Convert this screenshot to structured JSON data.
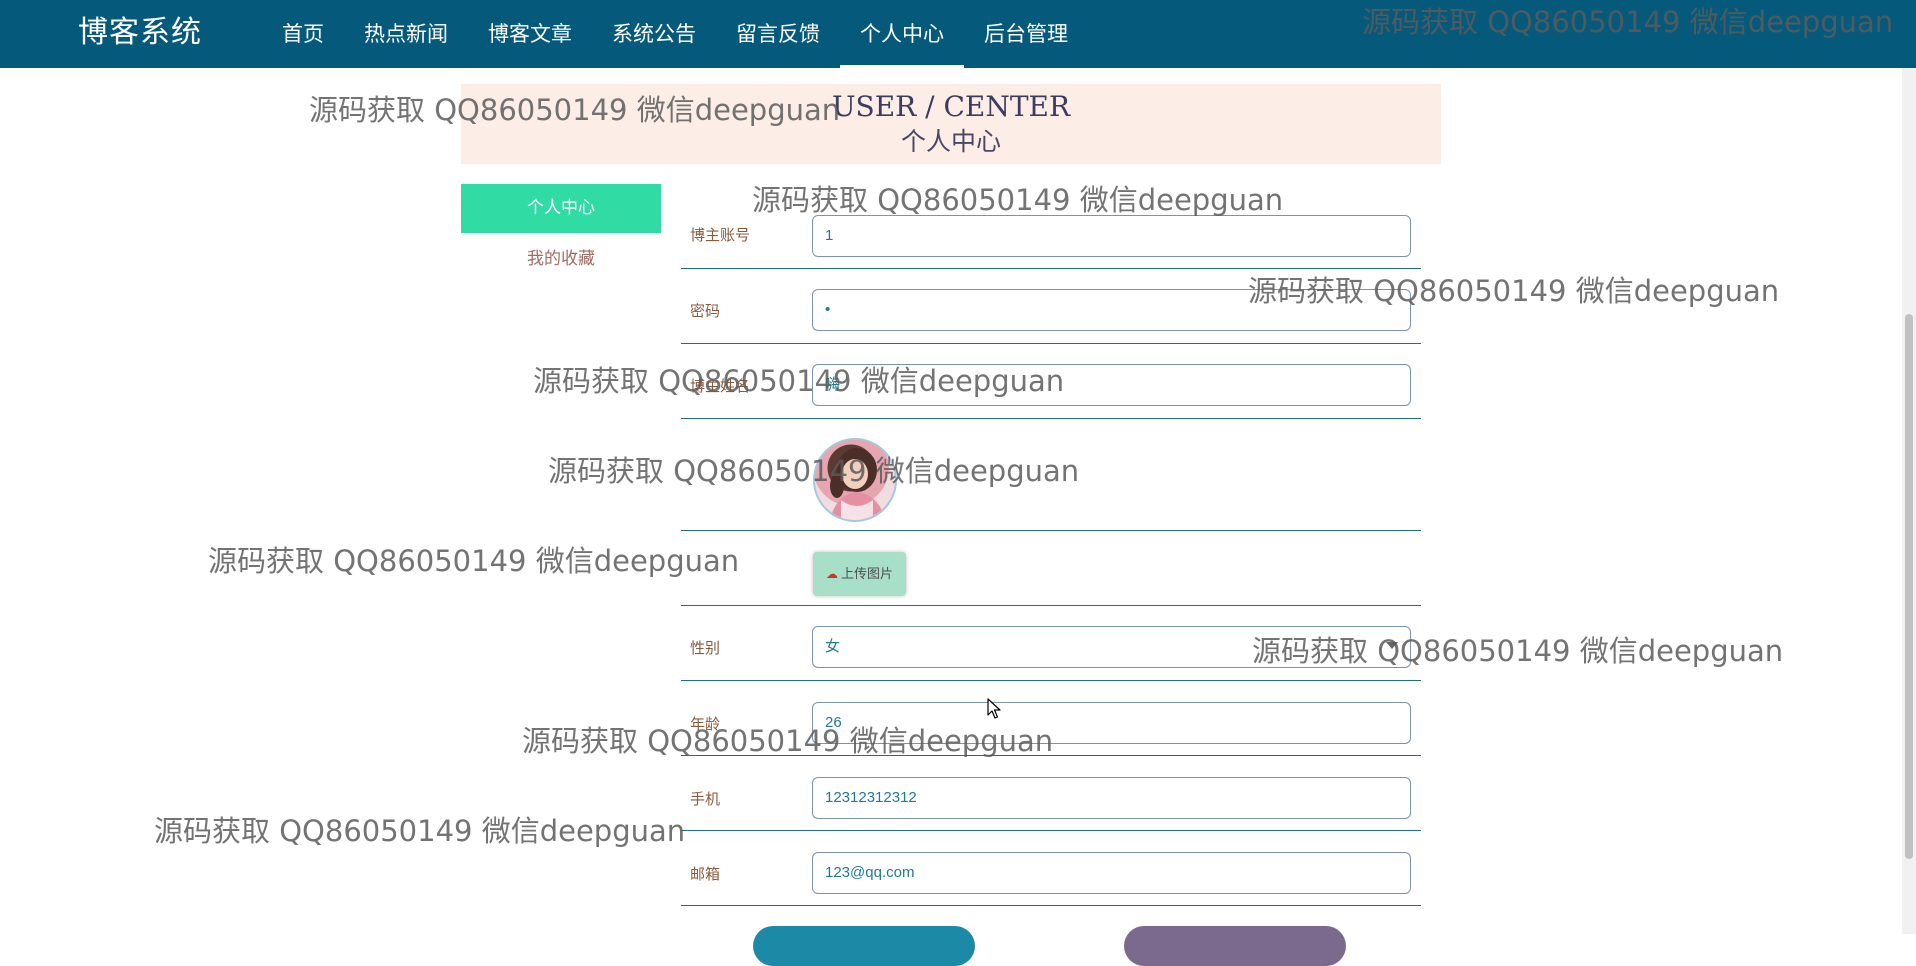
{
  "app": {
    "brand": "博客系统"
  },
  "nav": {
    "items": [
      "首页",
      "热点新闻",
      "博客文章",
      "系统公告",
      "留言反馈",
      "个人中心",
      "后台管理"
    ],
    "active": "个人中心"
  },
  "banner": {
    "title_en": "USER / CENTER",
    "title_cn": "个人中心"
  },
  "sidebar": {
    "active_label": "个人中心",
    "items": [
      {
        "label": "我的收藏"
      }
    ]
  },
  "form": {
    "account": {
      "label": "博主账号",
      "value": "1"
    },
    "password": {
      "label": "密码",
      "value": "•"
    },
    "nickname": {
      "label": "博主姓名",
      "value": "嗨"
    },
    "upload": {
      "label": "上传图片",
      "icon": "cloud-upload-icon"
    },
    "gender": {
      "label": "性别",
      "value": "女"
    },
    "age": {
      "label": "年龄",
      "value": "26"
    },
    "phone": {
      "label": "手机",
      "value": "12312312312"
    },
    "email": {
      "label": "邮箱",
      "value": "123@qq.com"
    }
  },
  "watermark": {
    "text": "源码获取 QQ86050149 微信deepguan"
  },
  "colors": {
    "nav_bg": "#055a7b",
    "banner_bg": "#fcede6",
    "sidebar_active": "#30dca4",
    "upload_btn": "#a8dfc8",
    "label_text": "#8a5a3c",
    "input_text": "#1f7a93"
  }
}
